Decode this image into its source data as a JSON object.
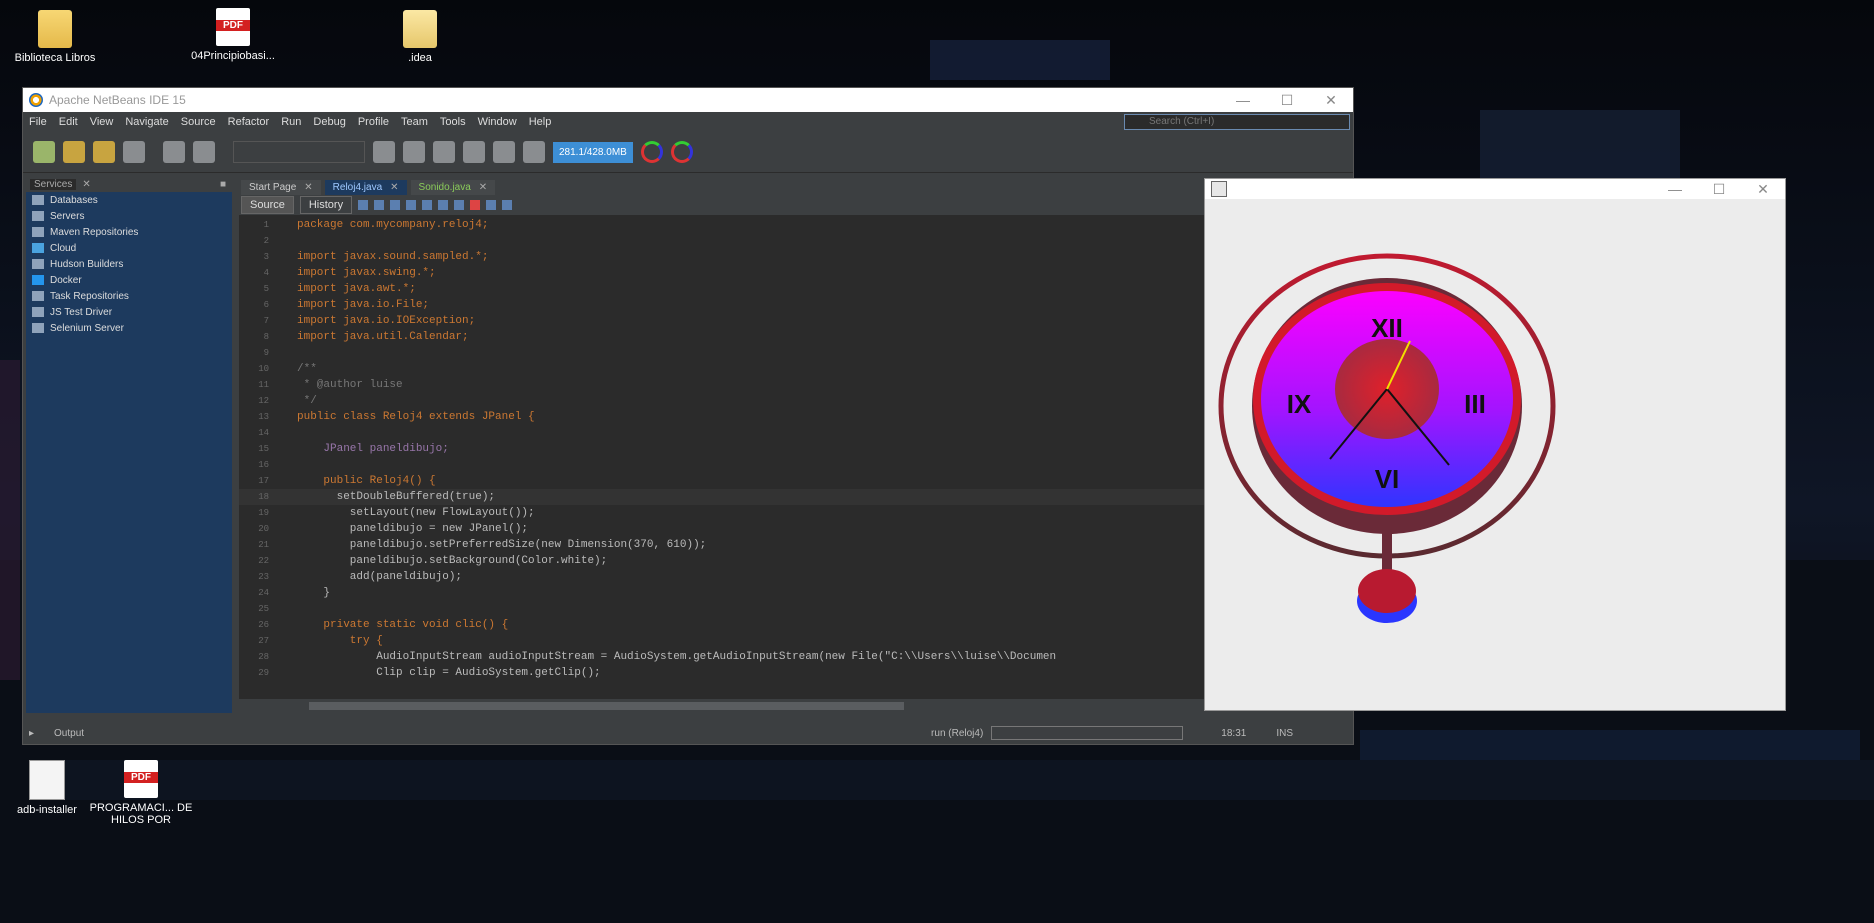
{
  "desktop": {
    "icons": [
      {
        "label": "Biblioteca Libros",
        "type": "folder"
      },
      {
        "label": "04Principiobasi...",
        "type": "pdf"
      },
      {
        "label": ".idea",
        "type": "folder"
      },
      {
        "label": "adb-installer",
        "type": "file"
      },
      {
        "label": "PROGRAMACI... DE HILOS POR",
        "type": "pdf"
      }
    ]
  },
  "netbeans": {
    "title": "Apache NetBeans IDE 15",
    "menu": [
      "File",
      "Edit",
      "View",
      "Navigate",
      "Source",
      "Refactor",
      "Run",
      "Debug",
      "Profile",
      "Team",
      "Tools",
      "Window",
      "Help"
    ],
    "search_placeholder": "Search (Ctrl+I)",
    "memory": "281.1/428.0MB",
    "services": {
      "title": "Services",
      "items": [
        "Databases",
        "Servers",
        "Maven Repositories",
        "Cloud",
        "Hudson Builders",
        "Docker",
        "Task Repositories",
        "JS Test Driver",
        "Selenium Server"
      ]
    },
    "tabs": [
      {
        "label": "Start Page",
        "active": false
      },
      {
        "label": "Reloj4.java",
        "active": true
      },
      {
        "label": "Sonido.java",
        "active": false
      }
    ],
    "editor_buttons": {
      "source": "Source",
      "history": "History"
    },
    "code": [
      {
        "n": "1",
        "t": "package com.mycompany.reloj4;"
      },
      {
        "n": "2",
        "t": ""
      },
      {
        "n": "3",
        "t": "import javax.sound.sampled.*;"
      },
      {
        "n": "4",
        "t": "import javax.swing.*;"
      },
      {
        "n": "5",
        "t": "import java.awt.*;"
      },
      {
        "n": "6",
        "t": "import java.io.File;"
      },
      {
        "n": "7",
        "t": "import java.io.IOException;"
      },
      {
        "n": "8",
        "t": "import java.util.Calendar;"
      },
      {
        "n": "9",
        "t": ""
      },
      {
        "n": "10",
        "t": "/**"
      },
      {
        "n": "11",
        "t": " * @author luise"
      },
      {
        "n": "12",
        "t": " */"
      },
      {
        "n": "13",
        "t": "public class Reloj4 extends JPanel {"
      },
      {
        "n": "14",
        "t": ""
      },
      {
        "n": "15",
        "t": "    JPanel paneldibujo;"
      },
      {
        "n": "16",
        "t": ""
      },
      {
        "n": "17",
        "t": "    public Reloj4() {"
      },
      {
        "n": "18",
        "t": "      setDoubleBuffered(true);"
      },
      {
        "n": "19",
        "t": "        setLayout(new FlowLayout());"
      },
      {
        "n": "20",
        "t": "        paneldibujo = new JPanel();"
      },
      {
        "n": "21",
        "t": "        paneldibujo.setPreferredSize(new Dimension(370, 610));"
      },
      {
        "n": "22",
        "t": "        paneldibujo.setBackground(Color.white);"
      },
      {
        "n": "23",
        "t": "        add(paneldibujo);"
      },
      {
        "n": "24",
        "t": "    }"
      },
      {
        "n": "25",
        "t": ""
      },
      {
        "n": "26",
        "t": "    private static void clic() {"
      },
      {
        "n": "27",
        "t": "        try {"
      },
      {
        "n": "28",
        "t": "            AudioInputStream audioInputStream = AudioSystem.getAudioInputStream(new File(\"C:\\\\Users\\\\luise\\\\Documen"
      },
      {
        "n": "29",
        "t": "            Clip clip = AudioSystem.getClip();"
      }
    ],
    "status": {
      "output_tab": "Output",
      "run_label": "run (Reloj4)",
      "position": "18:31",
      "mode": "INS"
    }
  },
  "clock": {
    "numerals": [
      "XII",
      "III",
      "VI",
      "IX"
    ],
    "colors": {
      "outer_ring": "#b4182a",
      "face_top": "#ff00ff",
      "face_bottom": "#2a36ff",
      "center": "#e01a2b",
      "second_hand": "#f0e000",
      "hands": "#111111"
    }
  }
}
